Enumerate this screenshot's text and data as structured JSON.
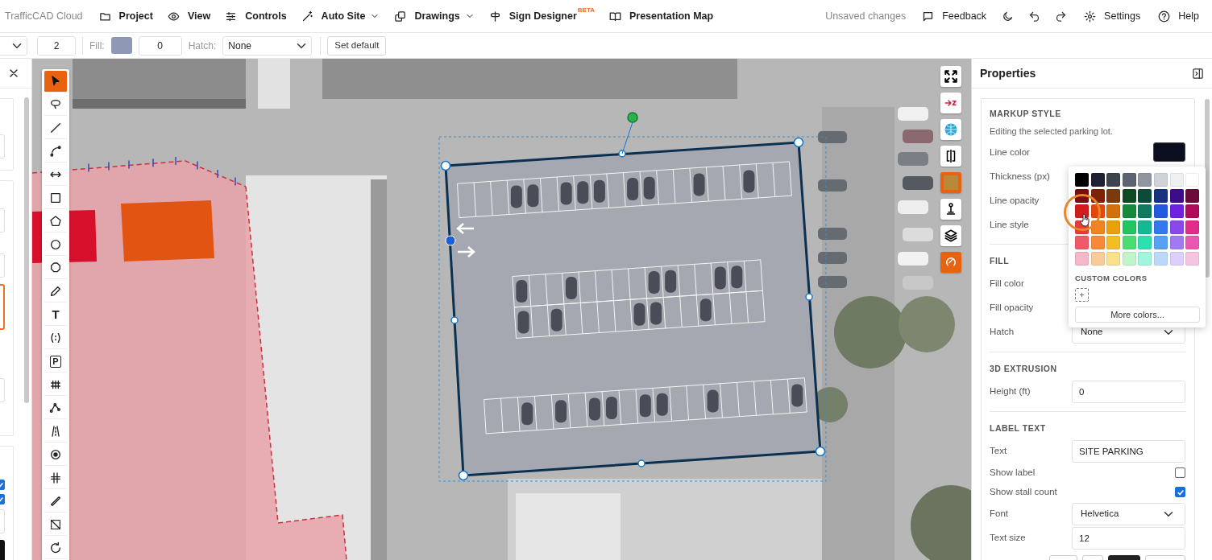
{
  "app": {
    "title": "TrafficCAD Cloud"
  },
  "menu": [
    {
      "label": "Project",
      "dropdown": false
    },
    {
      "label": "View",
      "dropdown": false
    },
    {
      "label": "Controls",
      "dropdown": false
    },
    {
      "label": "Auto Site",
      "dropdown": true
    },
    {
      "label": "Drawings",
      "dropdown": true
    },
    {
      "label": "Sign Designer",
      "dropdown": false,
      "badge": "BETA"
    },
    {
      "label": "Presentation Map",
      "dropdown": false
    }
  ],
  "status": "Unsaved changes",
  "actions": [
    {
      "kind": "labeled",
      "label": "Feedback"
    },
    {
      "kind": "icon"
    },
    {
      "kind": "icon"
    },
    {
      "kind": "icon"
    },
    {
      "kind": "labeled",
      "label": "Settings"
    },
    {
      "kind": "labeled",
      "label": "Help"
    }
  ],
  "toolbar": {
    "thickness": "2",
    "fill_label": "Fill:",
    "fill_opacity": "0",
    "hatch_label": "Hatch:",
    "hatch": "None",
    "set_default": "Set default"
  },
  "left_panel": {
    "checkboxes": [
      {
        "checked": true
      },
      {
        "checked": true
      }
    ]
  },
  "tools": [
    {
      "selected": true
    },
    {
      "selected": false
    },
    {
      "selected": false
    },
    {
      "selected": false
    },
    {
      "selected": false
    },
    {
      "selected": false
    },
    {
      "selected": false
    },
    {
      "selected": false
    },
    {
      "selected": false
    },
    {
      "selected": false
    },
    {
      "selected": false,
      "text": "T"
    },
    {
      "selected": false
    },
    {
      "selected": false,
      "text": "P"
    },
    {
      "selected": false
    },
    {
      "selected": false
    },
    {
      "selected": false
    },
    {
      "selected": false
    },
    {
      "selected": false
    },
    {
      "selected": false
    },
    {
      "selected": false
    },
    {
      "selected": false
    }
  ],
  "map_controls": [
    {
      "on": false
    },
    {
      "on": false
    },
    {
      "on": false
    },
    {
      "on": false
    },
    {
      "on": true
    },
    {
      "on": false
    },
    {
      "on": false
    },
    {
      "on": true
    }
  ],
  "properties": {
    "title": "Properties",
    "sections": [
      {
        "heading": "MARKUP STYLE",
        "caption": "Editing the selected parking lot.",
        "rows": [
          {
            "kind": "color",
            "label": "Line color"
          },
          {
            "kind": "covered",
            "label": "Thickness (px)"
          },
          {
            "kind": "covered",
            "label": "Line opacity"
          },
          {
            "kind": "covered",
            "label": "Line style"
          }
        ]
      },
      {
        "heading": "FILL",
        "rows": [
          {
            "kind": "covered",
            "label": "Fill color"
          },
          {
            "kind": "covered",
            "label": "Fill opacity"
          },
          {
            "kind": "select",
            "label": "Hatch",
            "value": "None"
          }
        ]
      },
      {
        "heading": "3D EXTRUSION",
        "rows": [
          {
            "kind": "input",
            "label": "Height (ft)",
            "value": "0"
          }
        ]
      },
      {
        "heading": "LABEL TEXT",
        "rows": [
          {
            "kind": "input",
            "label": "Text",
            "value": "SITE PARKING"
          },
          {
            "kind": "checkbox",
            "label": "Show label",
            "checked": false
          },
          {
            "kind": "checkbox",
            "label": "Show stall count",
            "checked": true
          },
          {
            "kind": "select",
            "label": "Font",
            "value": "Helvetica"
          },
          {
            "kind": "input",
            "label": "Text size",
            "value": "12"
          },
          {
            "kind": "buttons",
            "buttons": [
              {
                "selected": false
              },
              {
                "selected": false
              },
              {
                "selected": true
              },
              {
                "selected": false
              }
            ]
          }
        ]
      }
    ]
  },
  "color_picker": {
    "swatches": [
      {
        "color": "#000000",
        "hovered": false
      },
      {
        "color": "#1c2231",
        "hovered": false
      },
      {
        "color": "#3d4450",
        "hovered": false
      },
      {
        "color": "#5e6373",
        "hovered": false
      },
      {
        "color": "#9096a0",
        "hovered": false
      },
      {
        "color": "#cfd3d8",
        "hovered": false
      },
      {
        "color": "#eef0f2",
        "hovered": false
      },
      {
        "color": "#ffffff",
        "hovered": false
      },
      {
        "color": "#7a0e0e",
        "hovered": false
      },
      {
        "color": "#7e2206",
        "hovered": false
      },
      {
        "color": "#7b3a0b",
        "hovered": false
      },
      {
        "color": "#0f4a25",
        "hovered": false
      },
      {
        "color": "#0d4a3a",
        "hovered": false
      },
      {
        "color": "#17307f",
        "hovered": false
      },
      {
        "color": "#3c0c8a",
        "hovered": false
      },
      {
        "color": "#6e0a3a",
        "hovered": false
      },
      {
        "color": "#d21c1c",
        "hovered": true
      },
      {
        "color": "#e2480d",
        "hovered": false
      },
      {
        "color": "#d2700a",
        "hovered": false
      },
      {
        "color": "#168a3a",
        "hovered": false
      },
      {
        "color": "#0f7a5e",
        "hovered": false
      },
      {
        "color": "#2358e0",
        "hovered": false
      },
      {
        "color": "#6e22e0",
        "hovered": false
      },
      {
        "color": "#b00a5a",
        "hovered": false
      },
      {
        "color": "#e83a3a",
        "hovered": false
      },
      {
        "color": "#f0841e",
        "hovered": false
      },
      {
        "color": "#eaa00a",
        "hovered": false
      },
      {
        "color": "#22c55e",
        "hovered": false
      },
      {
        "color": "#14b894",
        "hovered": false
      },
      {
        "color": "#3478f0",
        "hovered": false
      },
      {
        "color": "#8a48ec",
        "hovered": false
      },
      {
        "color": "#e02c8c",
        "hovered": false
      },
      {
        "color": "#ef5a6a",
        "hovered": false
      },
      {
        "color": "#f48a3a",
        "hovered": false
      },
      {
        "color": "#f2be22",
        "hovered": false
      },
      {
        "color": "#4ade70",
        "hovered": false
      },
      {
        "color": "#2ee0b0",
        "hovered": false
      },
      {
        "color": "#5aa0f0",
        "hovered": false
      },
      {
        "color": "#a07af0",
        "hovered": false
      },
      {
        "color": "#e858b0",
        "hovered": false
      },
      {
        "color": "#f5b8c8",
        "hovered": false
      },
      {
        "color": "#f8cc9a",
        "hovered": false
      },
      {
        "color": "#fbe08a",
        "hovered": false
      },
      {
        "color": "#bff5c8",
        "hovered": false
      },
      {
        "color": "#a0f5dc",
        "hovered": false
      },
      {
        "color": "#bcd8f8",
        "hovered": false
      },
      {
        "color": "#dcd0fa",
        "hovered": false
      },
      {
        "color": "#f5c4e0",
        "hovered": false
      }
    ],
    "custom_heading": "CUSTOM COLORS",
    "more": "More colors..."
  }
}
